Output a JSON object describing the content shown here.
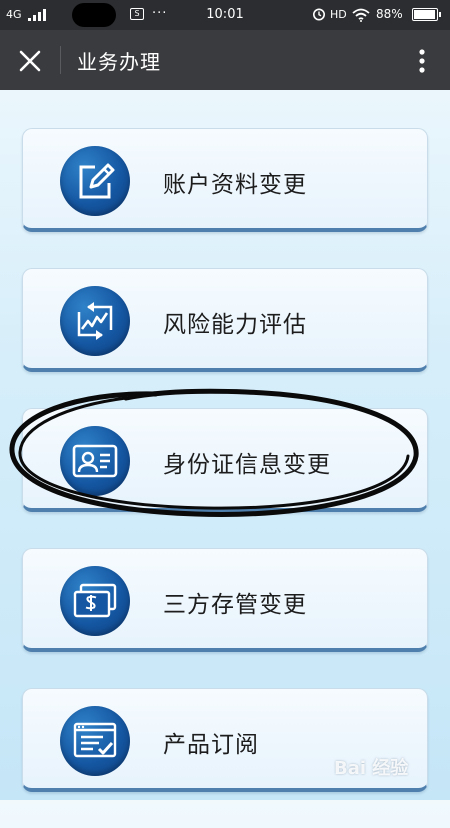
{
  "status_bar": {
    "network": "4G",
    "time": "10:01",
    "hd": "HD",
    "battery": "88%",
    "dots": "···",
    "notif_glyph": "S"
  },
  "app_bar": {
    "title": "业务办理",
    "close_icon": "close-icon",
    "more_icon": "more-vertical-icon"
  },
  "menu": {
    "items": [
      {
        "label": "账户资料变更",
        "icon": "edit-document-icon"
      },
      {
        "label": "风险能力评估",
        "icon": "trend-chart-icon"
      },
      {
        "label": "身份证信息变更",
        "icon": "id-card-icon"
      },
      {
        "label": "三方存管变更",
        "icon": "money-card-icon"
      },
      {
        "label": "产品订阅",
        "icon": "checklist-icon"
      }
    ]
  },
  "watermark": {
    "text": "Bai 经验"
  },
  "colors": {
    "status_bg": "#2b2d30",
    "app_bar_bg": "#3a3b3e",
    "icon_blue": "#1557a2",
    "card_border": "#4f7fac"
  }
}
